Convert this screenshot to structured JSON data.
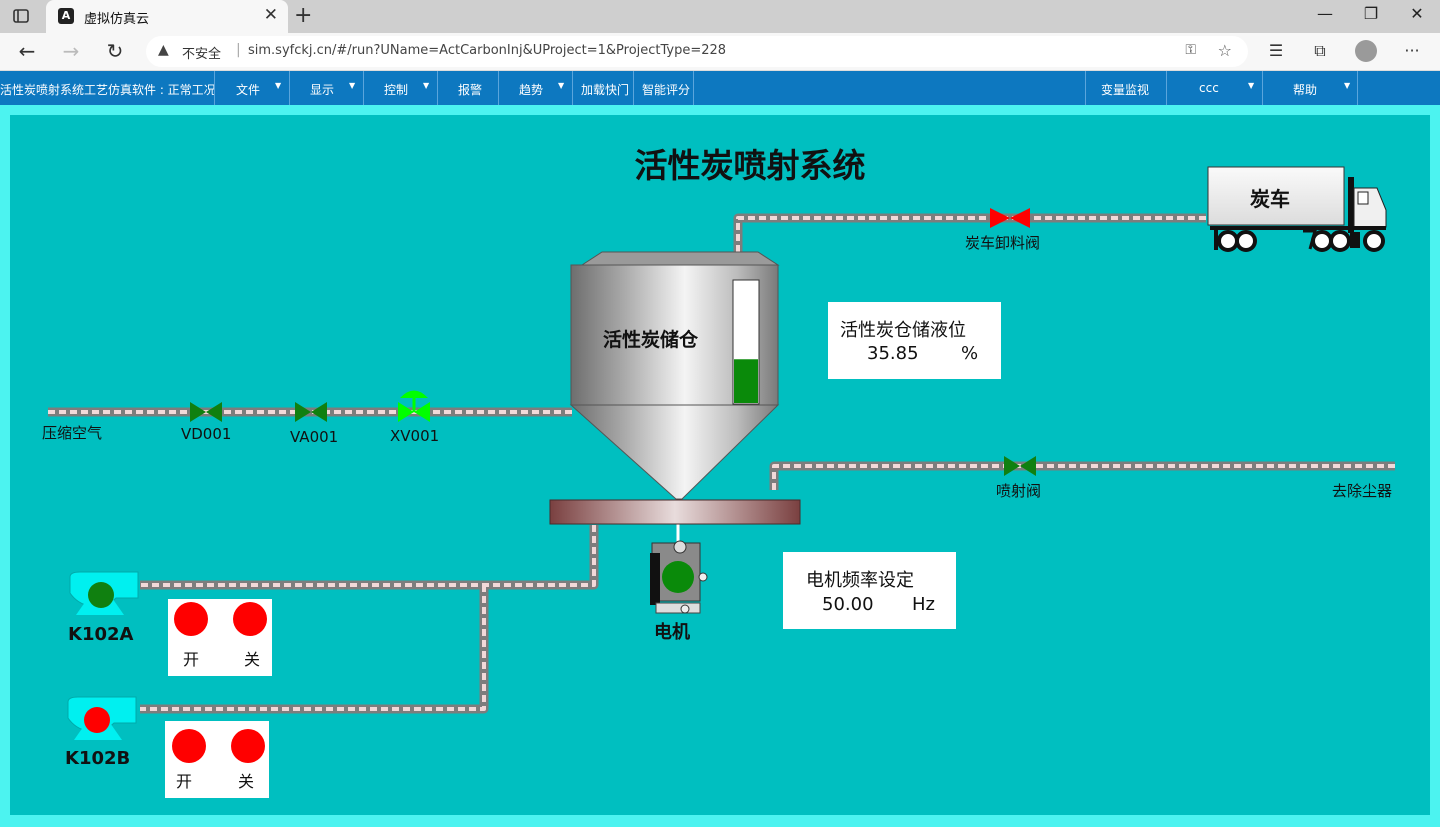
{
  "browser": {
    "tab_title": "虚拟仿真云",
    "insecure_label": "不安全",
    "url": "sim.syfckj.cn/#/run?UName=ActCarbonInj&UProject=1&ProjectType=228"
  },
  "menubar": {
    "app_title": "活性炭喷射系统工艺仿真软件 : 正常工况",
    "items": [
      {
        "label": "文件"
      },
      {
        "label": "显示"
      },
      {
        "label": "控制"
      },
      {
        "label": "报警"
      },
      {
        "label": "趋势"
      },
      {
        "label": "加载快门"
      },
      {
        "label": "智能评分"
      },
      {
        "label": "变量监视"
      },
      {
        "label": "ccc"
      },
      {
        "label": "帮助"
      }
    ]
  },
  "scene": {
    "title": "活性炭喷射系统",
    "truck_label": "炭车",
    "silo_label": "活性炭储仓",
    "silo_level_fraction": 0.3585,
    "valves": {
      "truck_unload": "炭车卸料阀",
      "vd001": "VD001",
      "va001": "VA001",
      "xv001": "XV001",
      "spray": "喷射阀"
    },
    "labels": {
      "compressed_air": "压缩空气",
      "dust_collector": "去除尘器",
      "motor": "电机",
      "fan_a": "K102A",
      "fan_b": "K102B"
    },
    "level_panel": {
      "title": "活性炭仓储液位",
      "value": "35.85",
      "unit": "%"
    },
    "freq_panel": {
      "title": "电机频率设定",
      "value": "50.00",
      "unit": "Hz"
    },
    "fan_a_buttons": {
      "on": "开",
      "off": "关"
    },
    "fan_b_buttons": {
      "on": "开",
      "off": "关"
    },
    "colors": {
      "canvas_bg": "#00bfc0",
      "valve_open": "#108010",
      "valve_closed": "#ff0000",
      "xv_active": "#00ff00"
    }
  }
}
